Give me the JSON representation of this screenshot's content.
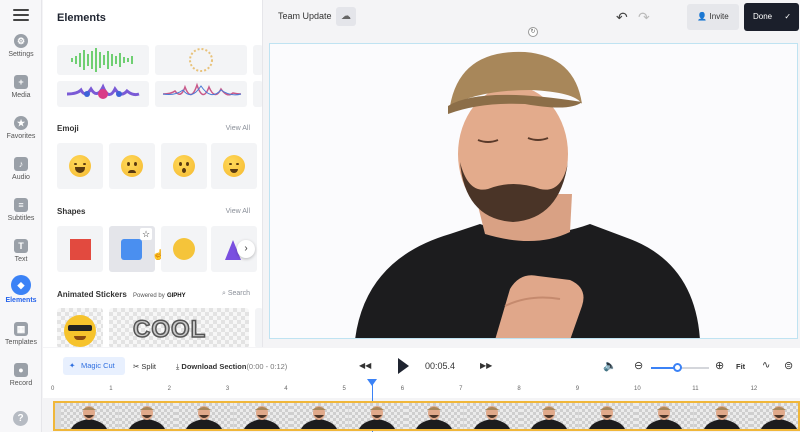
{
  "sidebar": {
    "items": [
      {
        "label": "Settings",
        "icon": "gear-icon"
      },
      {
        "label": "Media",
        "icon": "plus-icon"
      },
      {
        "label": "Favorites",
        "icon": "star-icon"
      },
      {
        "label": "Audio",
        "icon": "music-note-icon"
      },
      {
        "label": "Subtitles",
        "icon": "subtitles-icon"
      },
      {
        "label": "Text",
        "icon": "text-icon"
      },
      {
        "label": "Elements",
        "icon": "elements-icon",
        "active": true
      },
      {
        "label": "Templates",
        "icon": "templates-icon"
      },
      {
        "label": "Record",
        "icon": "record-icon"
      }
    ],
    "help": "?"
  },
  "panel": {
    "title": "Elements",
    "sections": {
      "emoji": {
        "title": "Emoji",
        "view_all": "View All"
      },
      "shapes": {
        "title": "Shapes",
        "view_all": "View All"
      },
      "stickers": {
        "title": "Animated Stickers",
        "powered_by": "Powered by",
        "giphy": "GIPHY",
        "search": "Search",
        "sticker_text": "COOL"
      }
    }
  },
  "topbar": {
    "project_name": "Team Update",
    "invite_label": "Invite",
    "done_label": "Done"
  },
  "controls": {
    "magic_cut": "Magic Cut",
    "split": "Split",
    "download": "Download Section",
    "download_range": "(0:00 - 0:12)",
    "time": "00:05.4",
    "fit": "Fit",
    "zoom_level": 0.45
  },
  "ruler": {
    "ticks": [
      "0",
      "1",
      "2",
      "3",
      "4",
      "5",
      "6",
      "7",
      "8",
      "9",
      "10",
      "11",
      "12"
    ]
  },
  "colors": {
    "accent": "#3b82f6",
    "done_bg": "#1b1f2b",
    "strip_border": "#f0b73a"
  }
}
